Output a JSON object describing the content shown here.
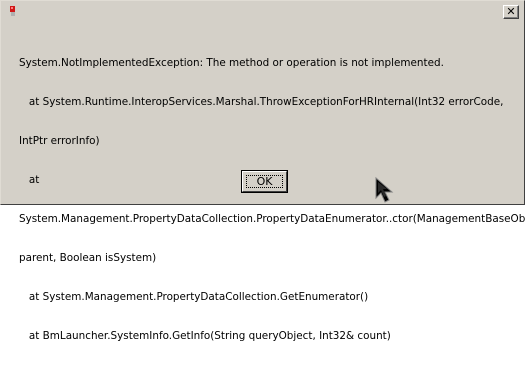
{
  "dialog": {
    "message_lines": [
      "System.NotImplementedException: The method or operation is not implemented.",
      "   at System.Runtime.InteropServices.Marshal.ThrowExceptionForHRInternal(Int32 errorCode,",
      "IntPtr errorInfo)",
      "   at",
      "System.Management.PropertyDataCollection.PropertyDataEnumerator..ctor(ManagementBaseObject",
      "parent, Boolean isSystem)",
      "   at System.Management.PropertyDataCollection.GetEnumerator()",
      "   at BmLauncher.SystemInfo.GetInfo(String queryObject, Int32& count)"
    ],
    "ok_label": "OK",
    "close_glyph": "✕"
  },
  "icons": {
    "app": "app-icon",
    "close": "close-icon",
    "cursor": "mouse-cursor-icon"
  },
  "colors": {
    "face": "#d4d0c8",
    "text": "#000000",
    "icon_red": "#d01818"
  }
}
